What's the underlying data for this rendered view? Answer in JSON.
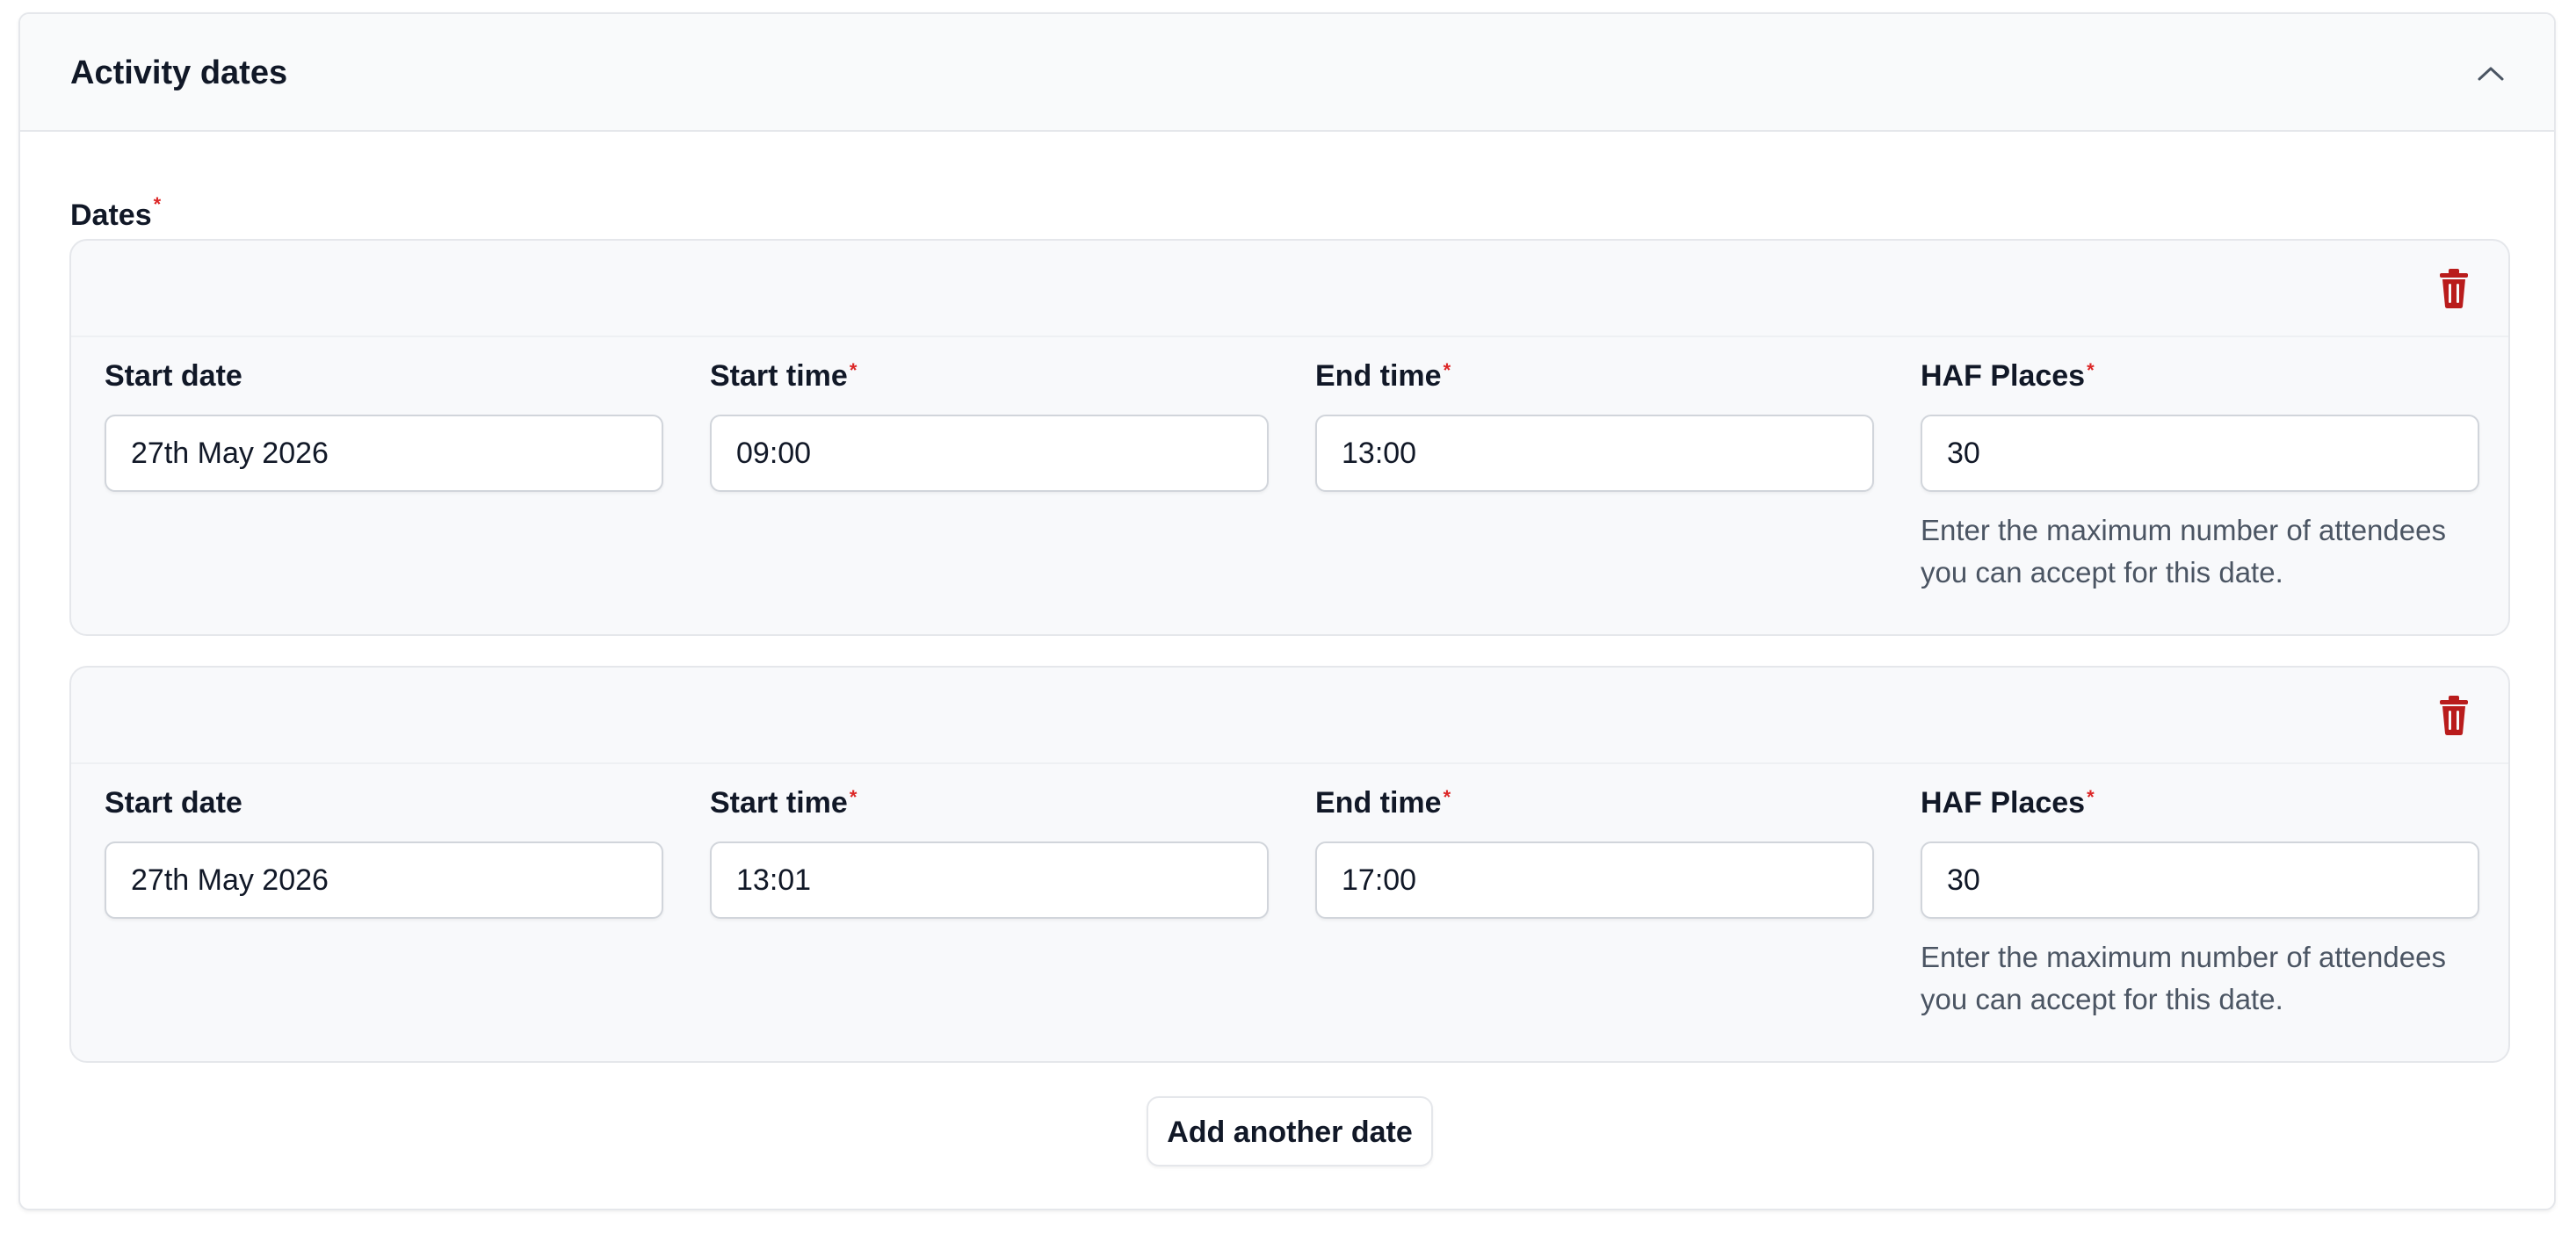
{
  "section": {
    "title": "Activity dates",
    "collapse_icon": "chevron-up-icon"
  },
  "dates_label": "Dates",
  "required_marker": "*",
  "delete_icon": "trash-icon",
  "accent_danger": "#b91c1c",
  "dates": [
    {
      "start_date_label": "Start date",
      "start_date": "27th May 2026",
      "start_time_label": "Start time",
      "start_time": "09:00",
      "end_time_label": "End time",
      "end_time": "13:00",
      "places_label": "HAF Places",
      "places": "30",
      "places_hint": "Enter the maximum number of attendees you can accept for this date."
    },
    {
      "start_date_label": "Start date",
      "start_date": "27th May 2026",
      "start_time_label": "Start time",
      "start_time": "13:01",
      "end_time_label": "End time",
      "end_time": "17:00",
      "places_label": "HAF Places",
      "places": "30",
      "places_hint": "Enter the maximum number of attendees you can accept for this date."
    }
  ],
  "add_button_label": "Add another date"
}
